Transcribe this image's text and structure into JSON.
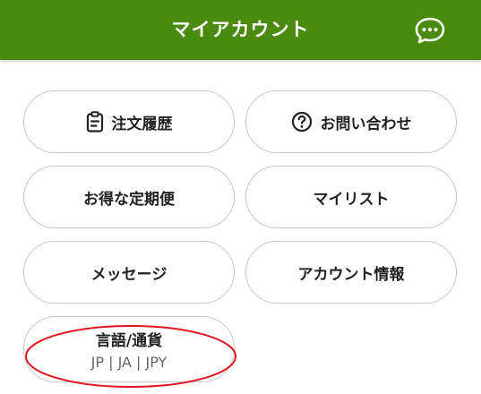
{
  "header": {
    "title": "マイアカウント",
    "chat_icon": "chat-bubble-icon",
    "background_color": "#4a8a0f"
  },
  "menu": {
    "order_history": {
      "label": "注文履歴",
      "icon": "clipboard-icon"
    },
    "contact": {
      "label": "お問い合わせ",
      "icon": "question-circle-icon"
    },
    "subscriptions": {
      "label": "お得な定期便"
    },
    "my_list": {
      "label": "マイリスト"
    },
    "messages": {
      "label": "メッセージ"
    },
    "account_info": {
      "label": "アカウント情報"
    },
    "language_currency": {
      "label": "言語/通貨",
      "value": "JP | JA | JPY"
    }
  },
  "annotation": {
    "highlight_color": "#e0151f"
  }
}
